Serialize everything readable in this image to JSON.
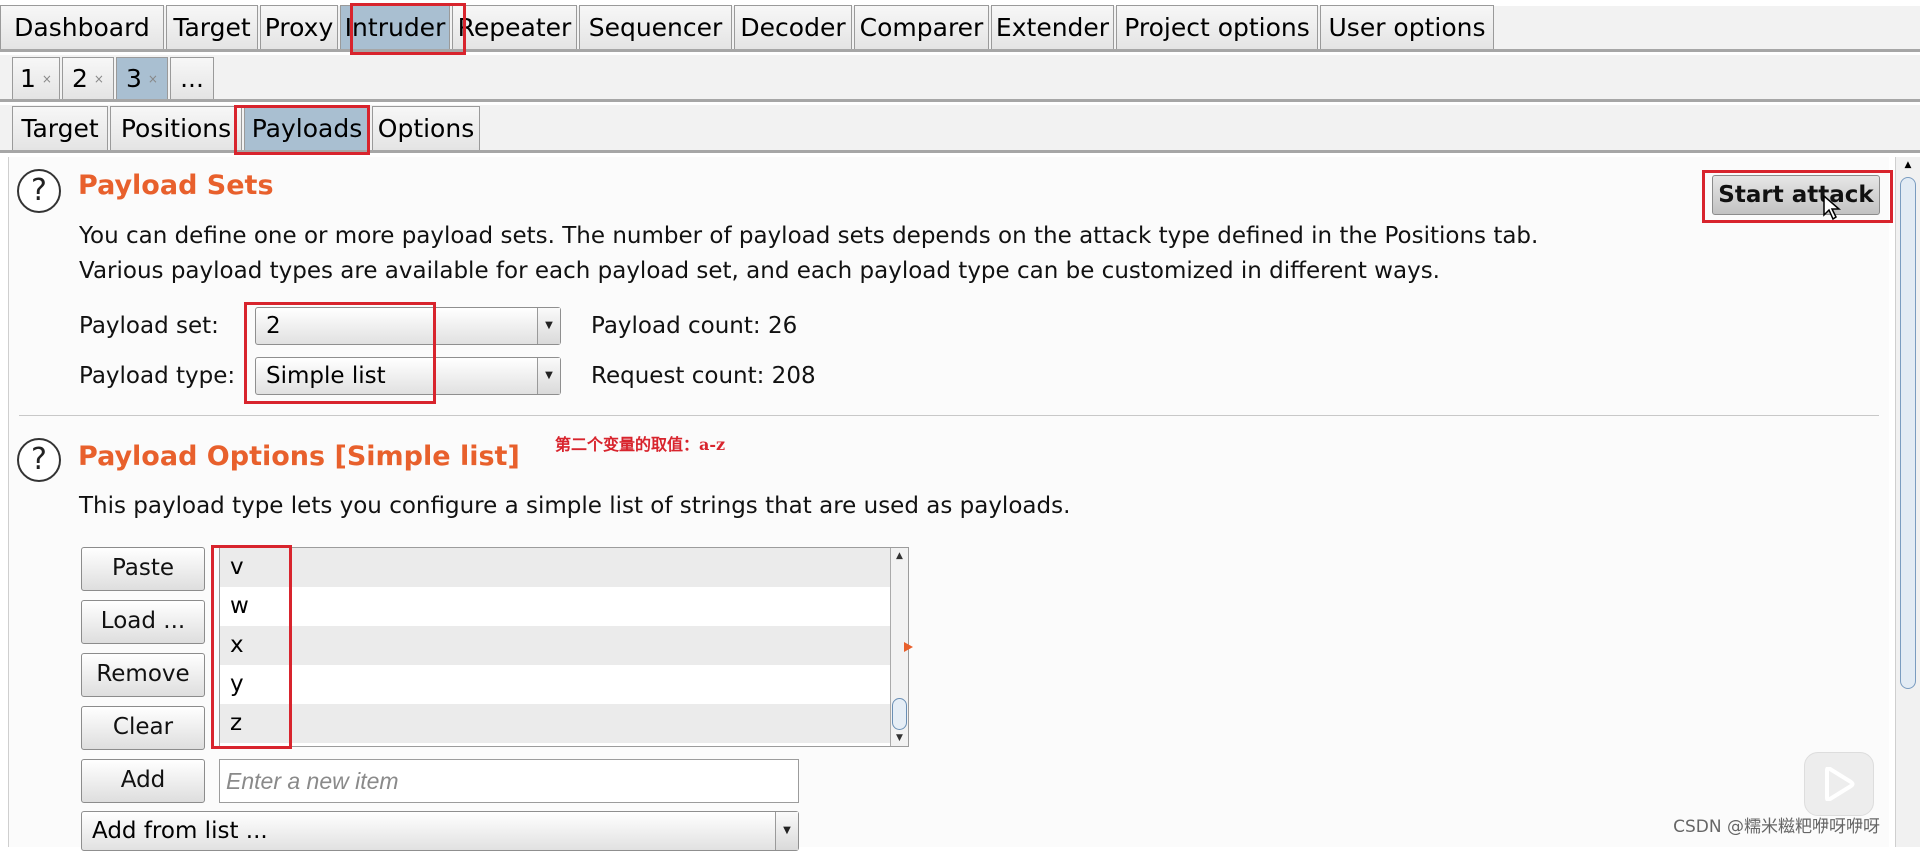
{
  "main_tabs": [
    {
      "label": "Dashboard"
    },
    {
      "label": "Target"
    },
    {
      "label": "Proxy"
    },
    {
      "label": "Intruder",
      "active": true
    },
    {
      "label": "Repeater"
    },
    {
      "label": "Sequencer"
    },
    {
      "label": "Decoder"
    },
    {
      "label": "Comparer"
    },
    {
      "label": "Extender"
    },
    {
      "label": "Project options"
    },
    {
      "label": "User options"
    }
  ],
  "attack_tabs": [
    {
      "label": "1",
      "close": "×"
    },
    {
      "label": "2",
      "close": "×"
    },
    {
      "label": "3",
      "close": "×",
      "active": true
    },
    {
      "label": "..."
    }
  ],
  "sub_tabs": [
    {
      "label": "Target"
    },
    {
      "label": "Positions"
    },
    {
      "label": "Payloads",
      "active": true
    },
    {
      "label": "Options"
    }
  ],
  "payload_sets": {
    "title": "Payload Sets",
    "start_attack_label": "Start attack",
    "desc_line1": "You can define one or more payload sets. The number of payload sets depends on the attack type defined in the Positions tab.",
    "desc_line2": "Various payload types are available for each payload set, and each payload type can be customized in different ways.",
    "set_label": "Payload set:",
    "set_value": "2",
    "type_label": "Payload type:",
    "type_value": "Simple list",
    "payload_count": "Payload count: 26",
    "request_count": "Request count: 208"
  },
  "payload_options": {
    "title": "Payload Options [Simple list]",
    "annotation": "第二个变量的取值：a-z",
    "desc": "This payload type lets you configure a simple list of strings that are used as payloads.",
    "buttons": {
      "paste": "Paste",
      "load": "Load ...",
      "remove": "Remove",
      "clear": "Clear",
      "add": "Add"
    },
    "items": [
      "v",
      "w",
      "x",
      "y",
      "z"
    ],
    "new_item_placeholder": "Enter a new item",
    "add_from_list": "Add from list ..."
  },
  "watermark": "CSDN @糯米糍粑咿呀咿呀",
  "colors": {
    "accent_orange": "#e8602c",
    "highlight_red": "#d8242d",
    "active_tab": "#a9bfd1"
  }
}
